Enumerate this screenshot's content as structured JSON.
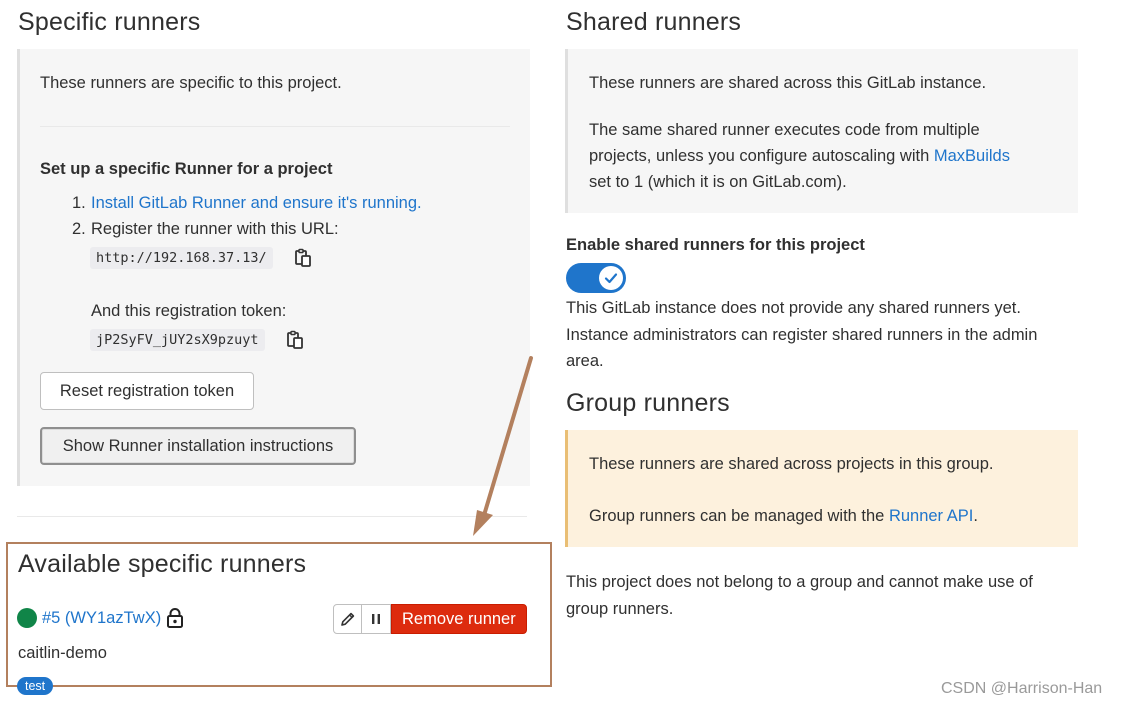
{
  "specific": {
    "title": "Specific runners",
    "intro": "These runners are specific to this project.",
    "setup_title": "Set up a specific Runner for a project",
    "step1_num": "1.",
    "step1_link": "Install GitLab Runner and ensure it's running.",
    "step2_num": "2.",
    "step2_text": "Register the runner with this URL:",
    "url": "http://192.168.37.13/",
    "token_label": "And this registration token:",
    "token": "jP2SyFV_jUY2sX9pzuyt",
    "reset_button": "Reset registration token",
    "show_button": "Show Runner installation instructions"
  },
  "available": {
    "title": "Available specific runners",
    "runner_link": "#5 (WY1azTwX)",
    "runner_name": "caitlin-demo",
    "tag": "test",
    "remove_button": "Remove runner"
  },
  "shared": {
    "title": "Shared runners",
    "line1": "These runners are shared across this GitLab instance.",
    "line2a": "The same shared runner executes code from multiple",
    "line2b": "projects, unless you configure autoscaling with ",
    "line2b_link": "MaxBuilds",
    "line2c": "set to 1 (which it is on GitLab.com).",
    "enable_label": "Enable shared runners for this project",
    "toggle_on": true,
    "note1": "This GitLab instance does not provide any shared runners yet.",
    "note2": "Instance administrators can register shared runners in the admin",
    "note3": "area."
  },
  "group": {
    "title": "Group runners",
    "line1": "These runners are shared across projects in this group.",
    "line2": "Group runners can be managed with the ",
    "line2_link": "Runner API",
    "line2_end": ".",
    "note1": "This project does not belong to a group and cannot make use of",
    "note2": "group runners."
  },
  "watermark": "CSDN @Harrison-Han",
  "colors": {
    "link": "#1f75cb",
    "danger": "#dd2b0e",
    "success": "#108548",
    "annotation": "#b3805e"
  }
}
